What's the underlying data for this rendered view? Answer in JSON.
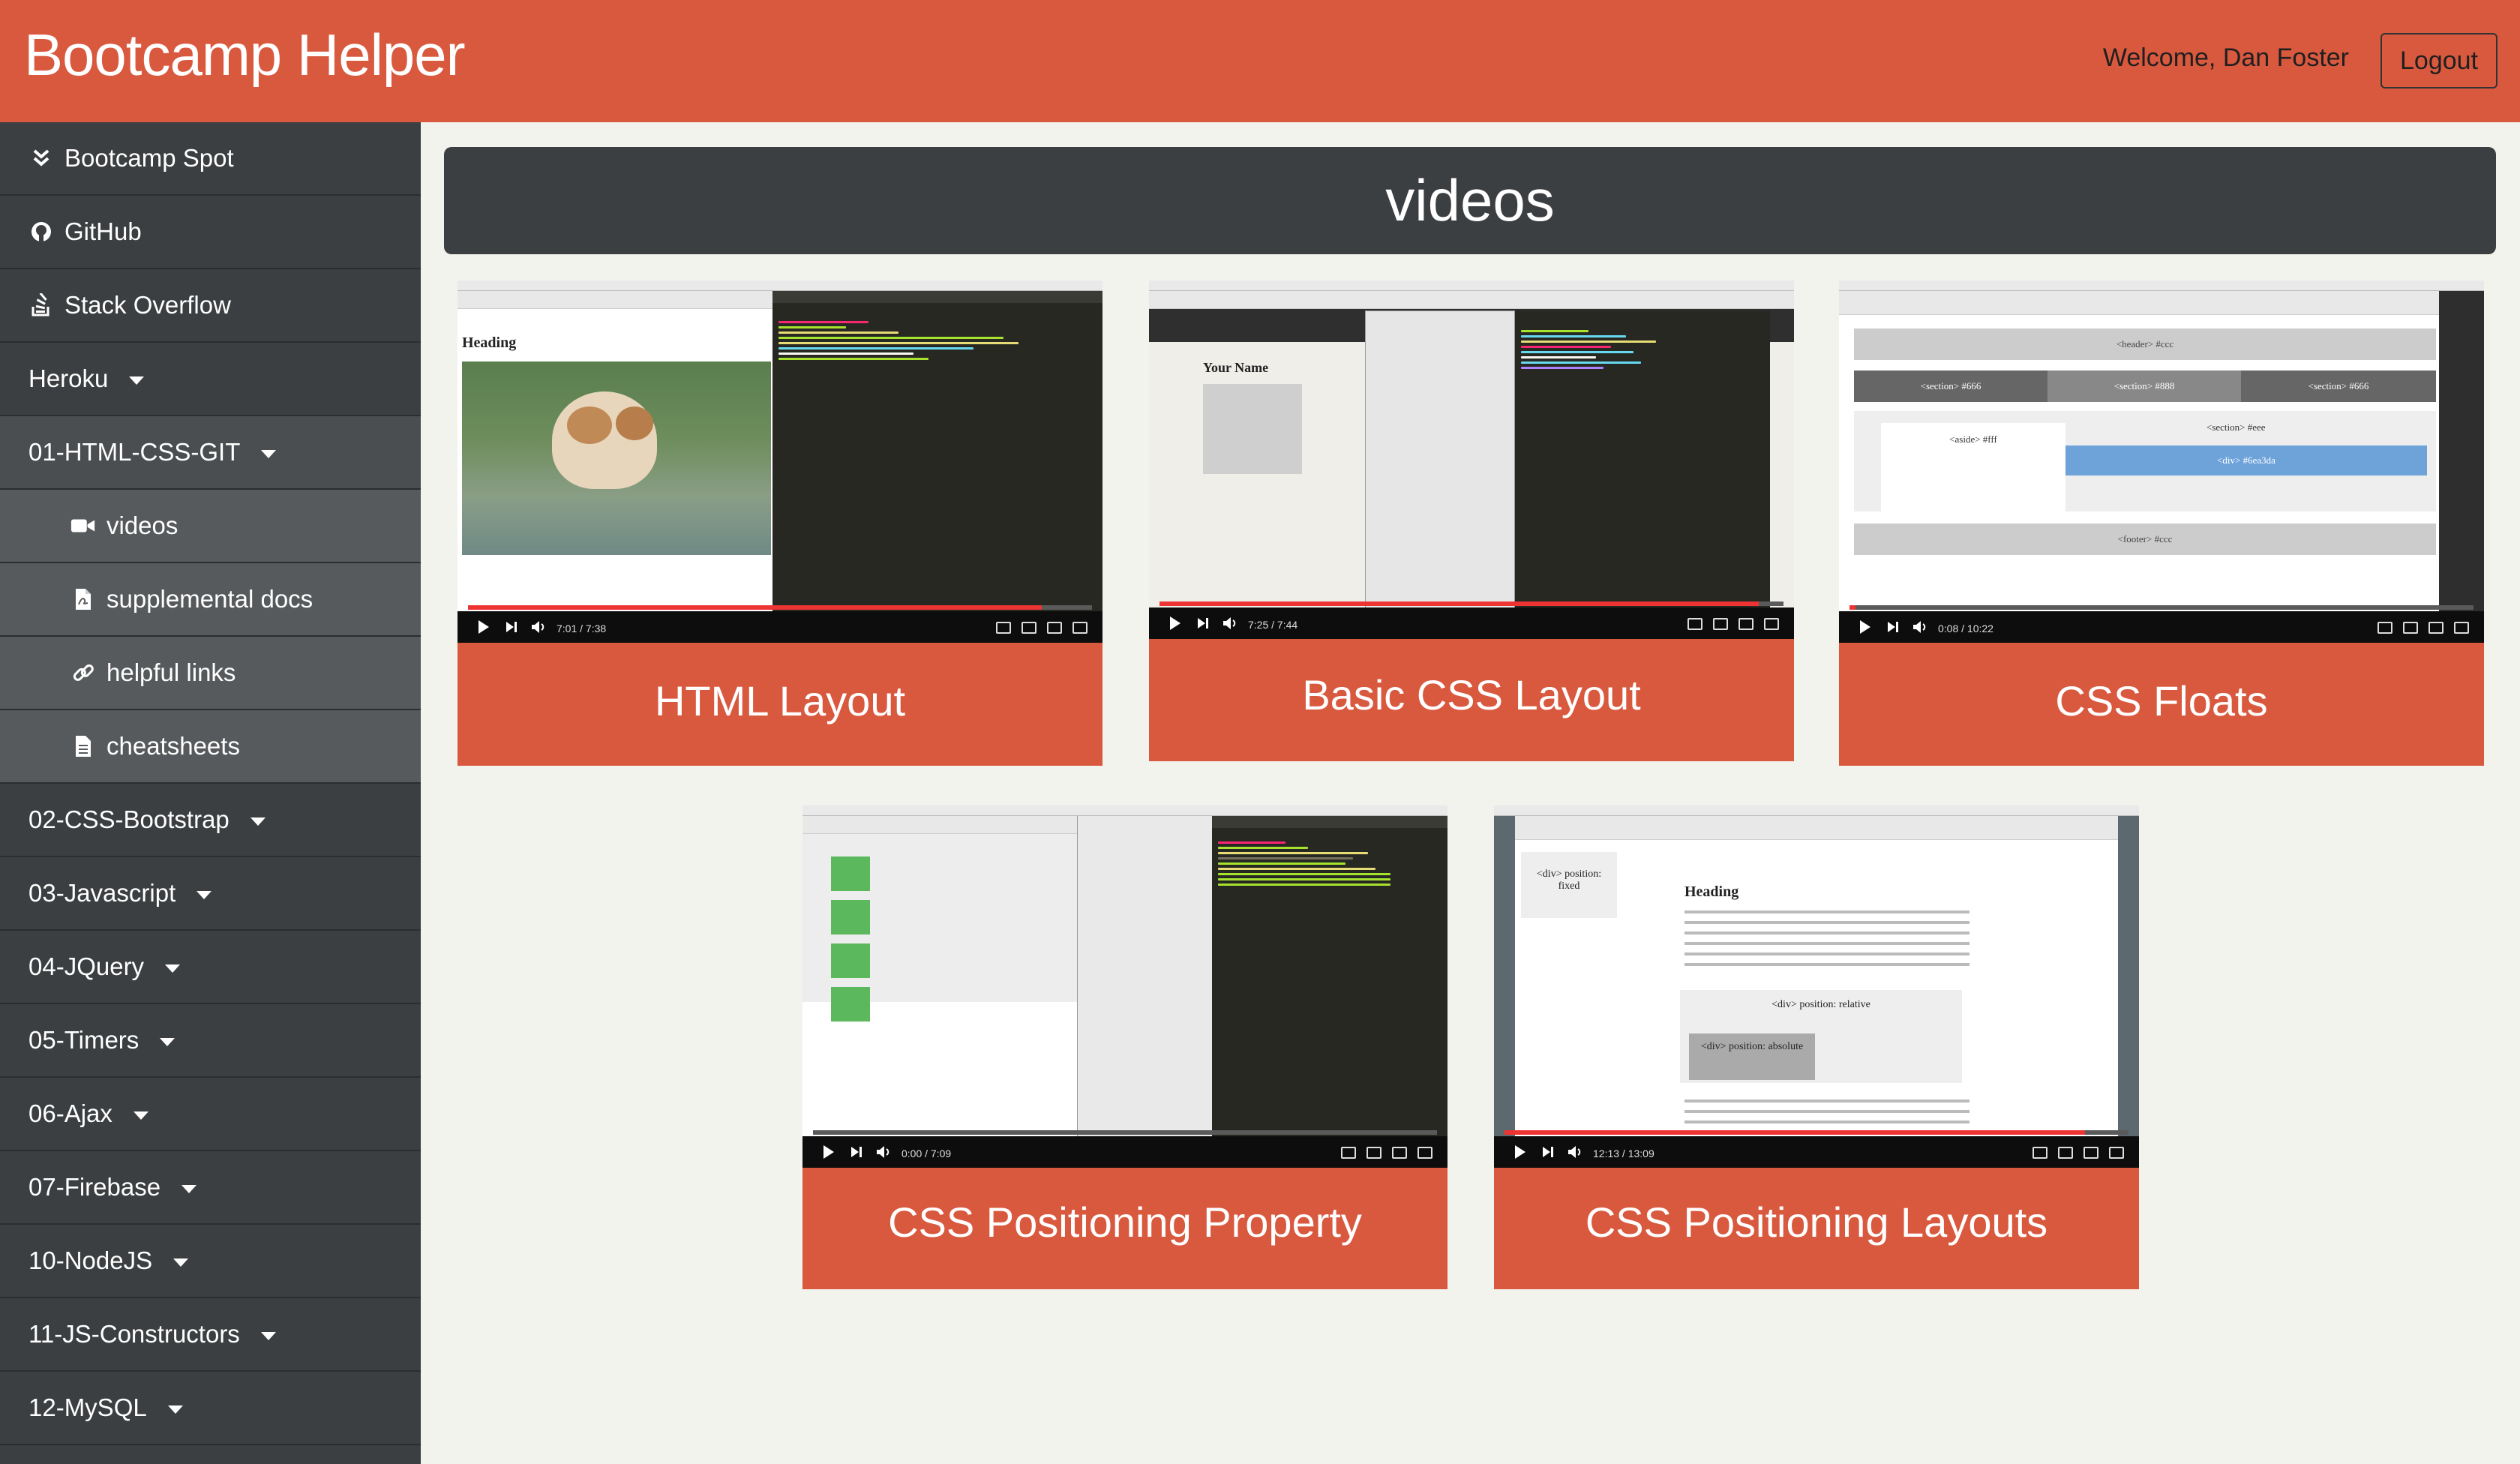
{
  "header": {
    "brand": "Bootcamp Helper",
    "welcome": "Welcome, Dan Foster",
    "logout_label": "Logout"
  },
  "sidebar": {
    "items": [
      {
        "label": "Bootcamp Spot",
        "icon": "double-chevron-down-icon"
      },
      {
        "label": "GitHub",
        "icon": "github-icon"
      },
      {
        "label": "Stack Overflow",
        "icon": "stack-overflow-icon"
      },
      {
        "label": "Heroku",
        "dropdown": true
      },
      {
        "label": "01-HTML-CSS-GIT",
        "dropdown": true,
        "expanded": true
      },
      {
        "label": "videos",
        "icon": "video-camera-icon",
        "sub": true,
        "selected": true
      },
      {
        "label": "supplemental docs",
        "icon": "file-pdf-icon",
        "sub": true
      },
      {
        "label": "helpful links",
        "icon": "link-icon",
        "sub": true
      },
      {
        "label": "cheatsheets",
        "icon": "file-text-icon",
        "sub": true
      },
      {
        "label": "02-CSS-Bootstrap",
        "dropdown": true
      },
      {
        "label": "03-Javascript",
        "dropdown": true
      },
      {
        "label": "04-JQuery",
        "dropdown": true
      },
      {
        "label": "05-Timers",
        "dropdown": true
      },
      {
        "label": "06-Ajax",
        "dropdown": true
      },
      {
        "label": "07-Firebase",
        "dropdown": true
      },
      {
        "label": "10-NodeJS",
        "dropdown": true
      },
      {
        "label": "11-JS-Constructors",
        "dropdown": true
      },
      {
        "label": "12-MySQL",
        "dropdown": true
      }
    ]
  },
  "main": {
    "heading": "videos",
    "videos": [
      {
        "title": "HTML Layout",
        "time": "7:01 / 7:38",
        "progress": 0.92
      },
      {
        "title": "Basic CSS Layout",
        "time": "7:25 / 7:44",
        "progress": 0.96
      },
      {
        "title": "CSS Floats",
        "time": "0:08 / 10:22",
        "progress": 0.01
      },
      {
        "title": "CSS Positioning Property",
        "time": "0:00 / 7:09",
        "progress": 0.0
      },
      {
        "title": "CSS Positioning Layouts",
        "time": "12:13 / 13:09",
        "progress": 0.93
      }
    ],
    "thumb_text": {
      "heading": "Heading",
      "your_name": "Your Name",
      "header_ccc": "<header> #ccc",
      "section_666": "<section> #666",
      "section_888": "<section> #888",
      "aside_fff": "<aside> #fff",
      "section_eee": "<section> #eee",
      "div_6ea3da": "<div> #6ea3da",
      "footer_ccc": "<footer> #ccc",
      "div_fixed": "<div> position: fixed",
      "div_relative": "<div> position: relative",
      "div_absolute": "<div> position: absolute"
    }
  },
  "colors": {
    "accent": "#d9593f",
    "sidebar": "#3c3f41",
    "background": "#f3f3ee"
  }
}
